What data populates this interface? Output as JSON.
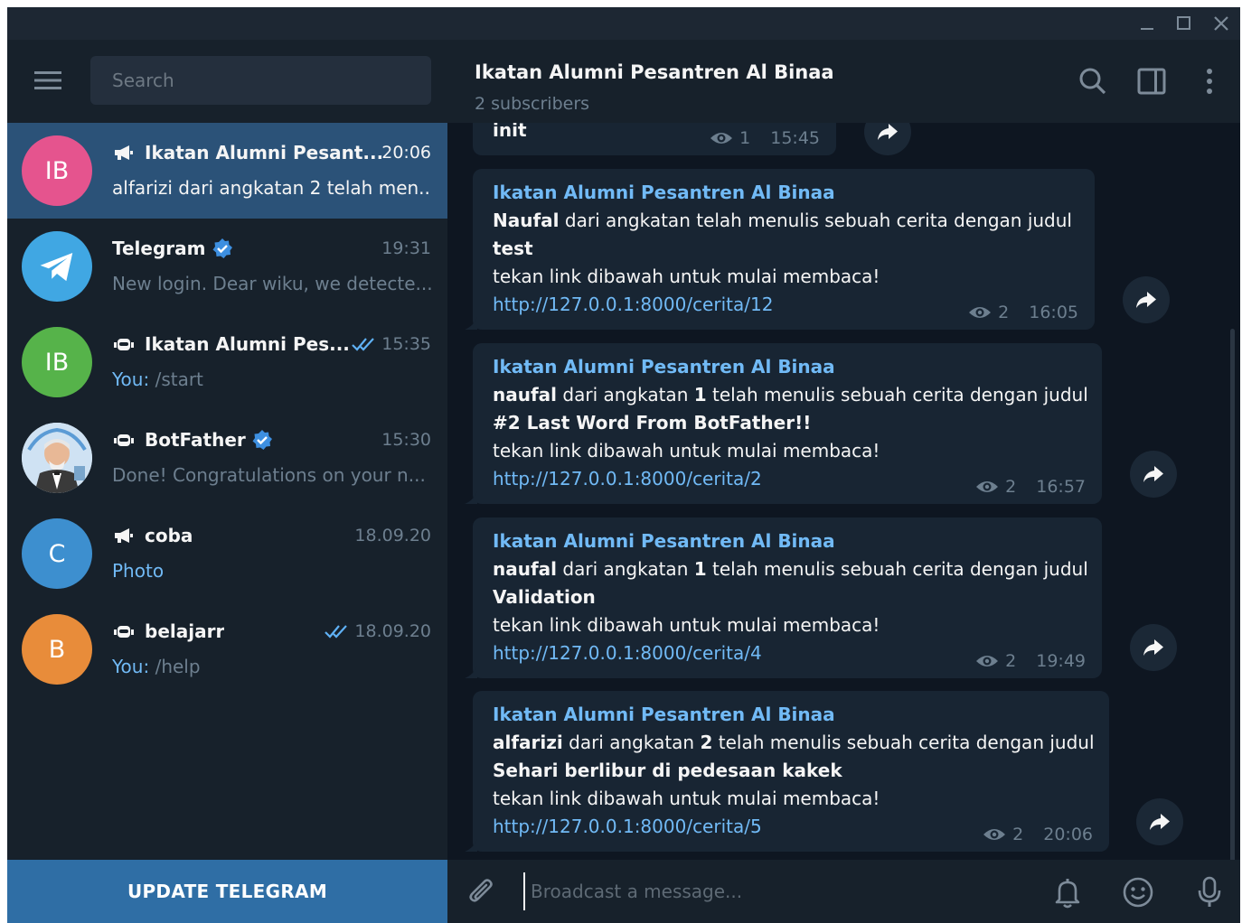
{
  "search": {
    "placeholder": "Search"
  },
  "chats": [
    {
      "name": "Ikatan Alumni Pesant...",
      "time": "20:06",
      "preview": "alfarizi dari angkatan 2 telah men...",
      "avatar_text": "IB",
      "avatar_color": "#e5548e",
      "type_icon": "megaphone-icon",
      "active": true
    },
    {
      "name": "Telegram",
      "time": "19:31",
      "preview": "New login. Dear wiku, we detecte...",
      "avatar_icon": "telegram-plane-icon",
      "avatar_color": "#40a7e3",
      "verified": true
    },
    {
      "name": "Ikatan Alumni Pes...",
      "time": "15:35",
      "preview_prefix": "You:",
      "preview": " /start",
      "avatar_text": "IB",
      "avatar_color": "#56b34a",
      "type_icon": "bot-icon",
      "read_check": true
    },
    {
      "name": "BotFather",
      "time": "15:30",
      "preview": "Done! Congratulations on your n...",
      "avatar_icon": "botfather-avatar-icon",
      "type_icon": "bot-icon",
      "verified": true
    },
    {
      "name": "coba",
      "time": "18.09.20",
      "preview_prefix": "Photo",
      "preview": "",
      "avatar_text": "C",
      "avatar_color": "#3d8fcf",
      "type_icon": "megaphone-icon"
    },
    {
      "name": "belajarr",
      "time": "18.09.20",
      "preview_prefix": "You:",
      "preview": " /help",
      "avatar_text": "B",
      "avatar_color": "#e88c3a",
      "type_icon": "bot-icon",
      "read_check": true
    }
  ],
  "update_button": "UPDATE TELEGRAM",
  "header": {
    "title": "Ikatan Alumni Pesantren Al Binaa",
    "subtitle": "2 subscribers"
  },
  "partial_message": {
    "text": "init",
    "views": "1",
    "time": "15:45"
  },
  "messages": [
    {
      "sender": "Ikatan Alumni Pesantren Al Binaa",
      "author": "Naufal",
      "line1_rest": " dari angkatan  telah menulis sebuah cerita dengan judul",
      "title": "test",
      "line3": "tekan link dibawah untuk mulai membaca!",
      "link": "http://127.0.0.1:8000/cerita/12",
      "views": "2",
      "time": "16:05"
    },
    {
      "sender": "Ikatan Alumni Pesantren Al Binaa",
      "author": "naufal",
      "line1_mid": " dari angkatan ",
      "grade": "1",
      "line1_rest": " telah menulis sebuah cerita dengan judul",
      "title": "#2 Last Word From BotFather!!",
      "line3": "tekan link dibawah untuk mulai membaca!",
      "link": "http://127.0.0.1:8000/cerita/2",
      "views": "2",
      "time": "16:57"
    },
    {
      "sender": "Ikatan Alumni Pesantren Al Binaa",
      "author": "naufal",
      "line1_mid": " dari angkatan ",
      "grade": "1",
      "line1_rest": " telah menulis sebuah cerita dengan judul",
      "title": "Validation",
      "line3": "tekan link dibawah untuk mulai membaca!",
      "link": "http://127.0.0.1:8000/cerita/4",
      "views": "2",
      "time": "19:49"
    },
    {
      "sender": "Ikatan Alumni Pesantren Al Binaa",
      "author": "alfarizi",
      "line1_mid": " dari angkatan ",
      "grade": "2",
      "line1_rest": " telah menulis sebuah cerita dengan judul",
      "title": "Sehari berlibur di pedesaan kakek",
      "line3": "tekan link dibawah untuk mulai membaca!",
      "link": "http://127.0.0.1:8000/cerita/5",
      "views": "2",
      "time": "20:06"
    }
  ],
  "composer": {
    "placeholder": "Broadcast a message..."
  },
  "colors": {
    "accent": "#2b5278",
    "link": "#71baf6",
    "bubble": "#182533",
    "update_button": "#2f6ea5"
  }
}
